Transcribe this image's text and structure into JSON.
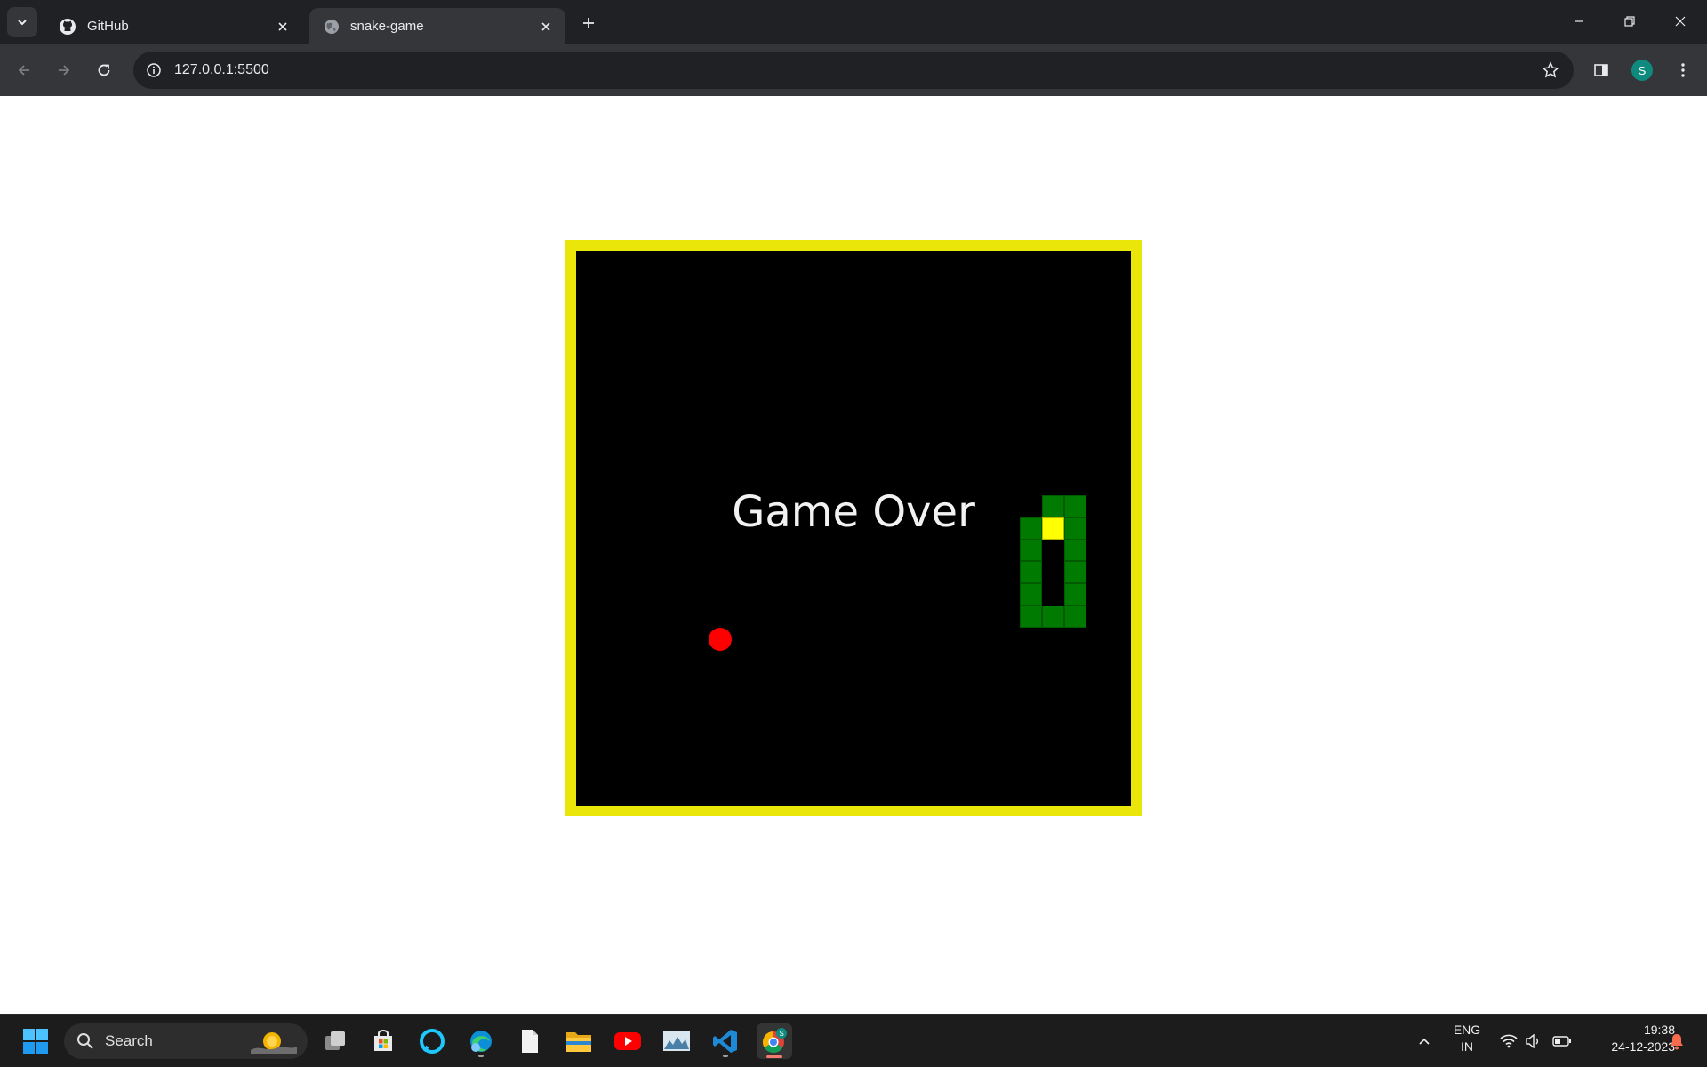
{
  "browser": {
    "tabs": [
      {
        "title": "GitHub",
        "icon": "github-icon",
        "active": false
      },
      {
        "title": "snake-game",
        "icon": "globe-icon",
        "active": true
      }
    ],
    "address_bar": {
      "url": "127.0.0.1:5500"
    },
    "profile_initial": "S"
  },
  "game": {
    "status_text": "Game Over",
    "colors": {
      "border": "#ebe60a",
      "board": "#000000",
      "snake": "#007a00",
      "snake_head": "#ffff00",
      "food": "#ff0000"
    },
    "grid_size": 25,
    "food": {
      "col": 6,
      "row": 17
    },
    "snake": [
      {
        "col": 21,
        "row": 12,
        "head": true
      },
      {
        "col": 21,
        "row": 11
      },
      {
        "col": 22,
        "row": 11
      },
      {
        "col": 22,
        "row": 12
      },
      {
        "col": 22,
        "row": 13
      },
      {
        "col": 22,
        "row": 14
      },
      {
        "col": 22,
        "row": 15
      },
      {
        "col": 22,
        "row": 16
      },
      {
        "col": 21,
        "row": 16
      },
      {
        "col": 20,
        "row": 16
      },
      {
        "col": 20,
        "row": 15
      },
      {
        "col": 20,
        "row": 14
      },
      {
        "col": 20,
        "row": 13
      },
      {
        "col": 20,
        "row": 12
      }
    ]
  },
  "taskbar": {
    "search_placeholder": "Search",
    "pinned": [
      "task-view-icon",
      "microsoft-store-icon",
      "alexa-icon",
      "edge-icon",
      "file-icon",
      "file-explorer-icon",
      "youtube-icon",
      "photos-icon",
      "vscode-icon",
      "chrome-icon"
    ],
    "language": {
      "line1": "ENG",
      "line2": "IN"
    },
    "clock": {
      "time": "19:38",
      "date": "24-12-2023"
    }
  }
}
